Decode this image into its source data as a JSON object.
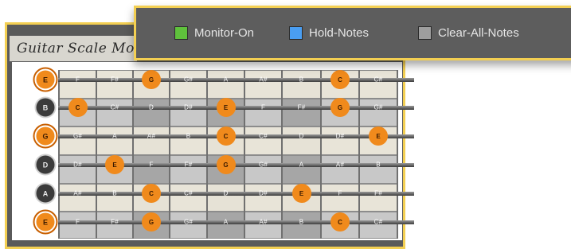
{
  "app": {
    "title": "Guitar Scale Monitor"
  },
  "toolbar": {
    "buttons": [
      {
        "label": "Monitor-On",
        "color": "#5fc13c"
      },
      {
        "label": "Hold-Notes",
        "color": "#4a9ef2"
      },
      {
        "label": "Clear-All-Notes",
        "color": "#9e9e9e"
      }
    ]
  },
  "fretboard": {
    "colors": {
      "marker": "#f08a1c",
      "marker_text": "#3a1a00",
      "open_dark": "#3b3b3b",
      "label": "#ffffff"
    },
    "strings": [
      {
        "open": "E",
        "open_active": true,
        "frets": [
          "F",
          "F#",
          "G",
          "G#",
          "A",
          "A#",
          "B",
          "C",
          "C#"
        ],
        "highlighted": [
          3,
          8
        ]
      },
      {
        "open": "B",
        "open_active": false,
        "frets": [
          "C",
          "C#",
          "D",
          "D#",
          "E",
          "F",
          "F#",
          "G",
          "G#"
        ],
        "highlighted": [
          1,
          5,
          8
        ]
      },
      {
        "open": "G",
        "open_active": true,
        "frets": [
          "G#",
          "A",
          "A#",
          "B",
          "C",
          "C#",
          "D",
          "D#",
          "E"
        ],
        "highlighted": [
          5,
          9
        ]
      },
      {
        "open": "D",
        "open_active": false,
        "frets": [
          "D#",
          "E",
          "F",
          "F#",
          "G",
          "G#",
          "A",
          "A#",
          "B"
        ],
        "highlighted": [
          2,
          5
        ]
      },
      {
        "open": "A",
        "open_active": false,
        "frets": [
          "A#",
          "B",
          "C",
          "C#",
          "D",
          "D#",
          "E",
          "F",
          "F#"
        ],
        "highlighted": [
          3,
          7
        ]
      },
      {
        "open": "E",
        "open_active": true,
        "frets": [
          "F",
          "F#",
          "G",
          "G#",
          "A",
          "A#",
          "B",
          "C",
          "C#"
        ],
        "highlighted": [
          3,
          8
        ]
      }
    ]
  }
}
